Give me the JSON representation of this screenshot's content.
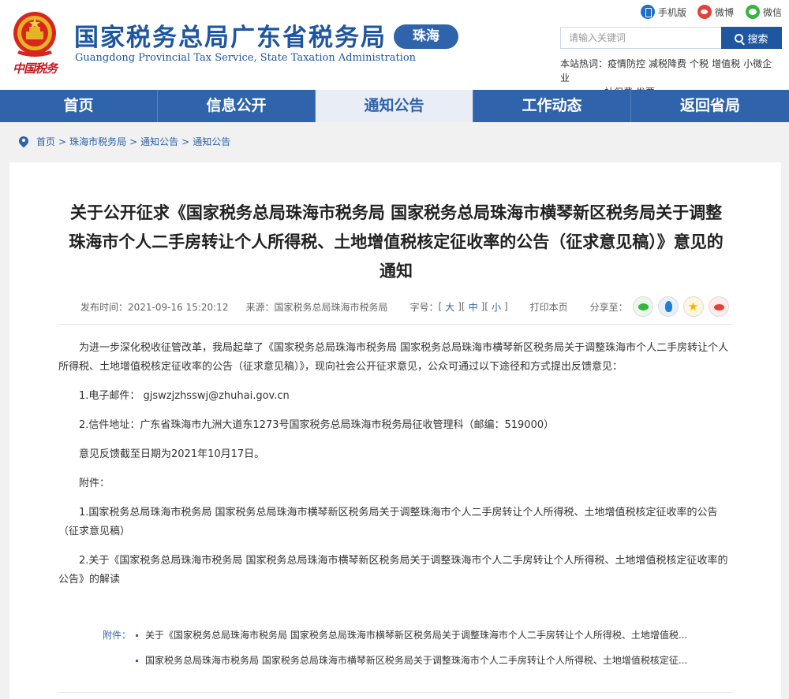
{
  "header": {
    "title": "国家税务总局广东省税务局",
    "subtitle": "Guangdong Provincial Tax Service, State Taxation Administration",
    "city_badge": "珠海",
    "emblem_script": "中国税务",
    "quick_links": [
      "手机版",
      "微博",
      "微信"
    ],
    "search_placeholder": "请输入关键词",
    "search_button": "搜索",
    "hot_label": "本站热词：",
    "hot_words": [
      "疫情防控",
      "减税降费",
      "个税",
      "增值税",
      "小微企业",
      "社保费",
      "发票"
    ]
  },
  "nav": {
    "items": [
      "首页",
      "信息公开",
      "通知公告",
      "工作动态",
      "返回省局"
    ],
    "active_index": 2
  },
  "breadcrumb": [
    "首页",
    "珠海市税务局",
    "通知公告",
    "通知公告"
  ],
  "article": {
    "title": "关于公开征求《国家税务总局珠海市税务局 国家税务总局珠海市横琴新区税务局关于调整珠海市个人二手房转让个人所得税、土地增值税核定征收率的公告（征求意见稿）》意见的通知",
    "publish_time": "发布时间：2021-09-16 15:20:12",
    "source": "来源：国家税务总局珠海市税务局",
    "font_size_label": "字号：",
    "font_sizes": [
      "大",
      "中",
      "小"
    ],
    "print": "打印本页",
    "share_label": "分享至：",
    "paragraphs": [
      "为进一步深化税收征管改革，我局起草了《国家税务总局珠海市税务局 国家税务总局珠海市横琴新区税务局关于调整珠海市个人二手房转让个人所得税、土地增值税核定征收率的公告（征求意见稿）》，现向社会公开征求意见，公众可通过以下途径和方式提出反馈意见：",
      "1.电子邮件： gjswzjzhsswj@zhuhai.gov.cn",
      "2.信件地址：广东省珠海市九洲大道东1273号国家税务总局珠海市税务局征收管理科（邮编：519000）",
      "意见反馈截至日期为2021年10月17日。",
      "附件：",
      "1.国家税务总局珠海市税务局 国家税务总局珠海市横琴新区税务局关于调整珠海市个人二手房转让个人所得税、土地增值税核定征收率的公告（征求意见稿）",
      "2.关于《国家税务总局珠海市税务局 国家税务总局珠海市横琴新区税务局关于调整珠海市个人二手房转让个人所得税、土地增值税核定征收率的公告》的解读"
    ],
    "attachments_label": "附件：",
    "attachments": [
      "关于《国家税务总局珠海市税务局 国家税务总局珠海市横琴新区税务局关于调整珠海市个人二手房转让个人所得税、土地增值税...",
      "国家税务总局珠海市税务局 国家税务总局珠海市横琴新区税务局关于调整珠海市个人二手房转让个人所得税、土地增值税核定征..."
    ]
  },
  "colors": {
    "brand_blue": "#2f63ab",
    "title_blue": "#1e56a0",
    "emblem_red": "#c8161d"
  }
}
